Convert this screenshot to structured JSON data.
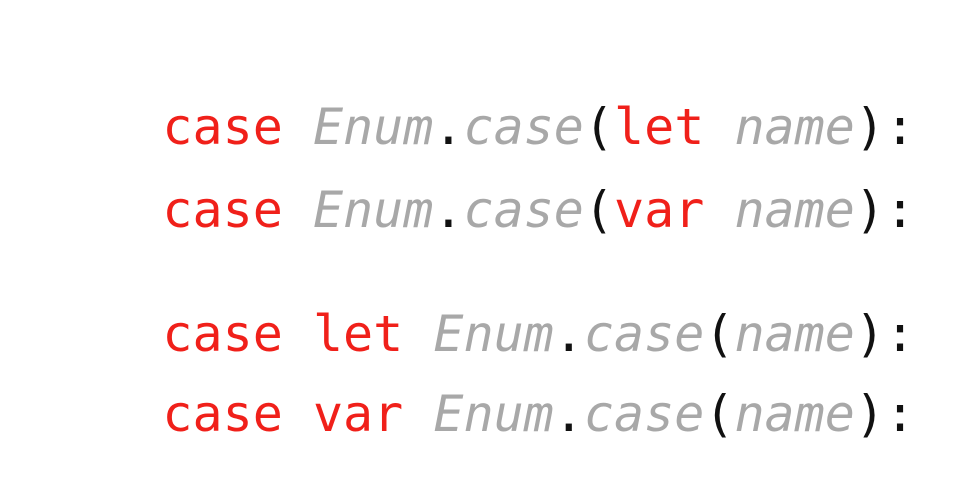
{
  "colors": {
    "keyword": "#f0201a",
    "identifier": "#a8a8a8",
    "punctuation": "#111111",
    "background": "#ffffff"
  },
  "lines": [
    {
      "tokens": [
        {
          "text": "case",
          "kind": "keyword"
        },
        {
          "text": " ",
          "kind": "space"
        },
        {
          "text": "Enum",
          "kind": "identifier"
        },
        {
          "text": ".",
          "kind": "punctuation"
        },
        {
          "text": "case",
          "kind": "identifier"
        },
        {
          "text": "(",
          "kind": "punctuation"
        },
        {
          "text": "let",
          "kind": "keyword"
        },
        {
          "text": " ",
          "kind": "space"
        },
        {
          "text": "name",
          "kind": "identifier"
        },
        {
          "text": "):",
          "kind": "punctuation"
        }
      ]
    },
    {
      "tokens": [
        {
          "text": "case",
          "kind": "keyword"
        },
        {
          "text": " ",
          "kind": "space"
        },
        {
          "text": "Enum",
          "kind": "identifier"
        },
        {
          "text": ".",
          "kind": "punctuation"
        },
        {
          "text": "case",
          "kind": "identifier"
        },
        {
          "text": "(",
          "kind": "punctuation"
        },
        {
          "text": "var",
          "kind": "keyword"
        },
        {
          "text": " ",
          "kind": "space"
        },
        {
          "text": "name",
          "kind": "identifier"
        },
        {
          "text": "):",
          "kind": "punctuation"
        }
      ]
    },
    {
      "tokens": [
        {
          "text": "case",
          "kind": "keyword"
        },
        {
          "text": " ",
          "kind": "space"
        },
        {
          "text": "let",
          "kind": "keyword"
        },
        {
          "text": " ",
          "kind": "space"
        },
        {
          "text": "Enum",
          "kind": "identifier"
        },
        {
          "text": ".",
          "kind": "punctuation"
        },
        {
          "text": "case",
          "kind": "identifier"
        },
        {
          "text": "(",
          "kind": "punctuation"
        },
        {
          "text": "name",
          "kind": "identifier"
        },
        {
          "text": "):",
          "kind": "punctuation"
        }
      ]
    },
    {
      "tokens": [
        {
          "text": "case",
          "kind": "keyword"
        },
        {
          "text": " ",
          "kind": "space"
        },
        {
          "text": "var",
          "kind": "keyword"
        },
        {
          "text": " ",
          "kind": "space"
        },
        {
          "text": "Enum",
          "kind": "identifier"
        },
        {
          "text": ".",
          "kind": "punctuation"
        },
        {
          "text": "case",
          "kind": "identifier"
        },
        {
          "text": "(",
          "kind": "punctuation"
        },
        {
          "text": "name",
          "kind": "identifier"
        },
        {
          "text": "):",
          "kind": "punctuation"
        }
      ]
    }
  ]
}
